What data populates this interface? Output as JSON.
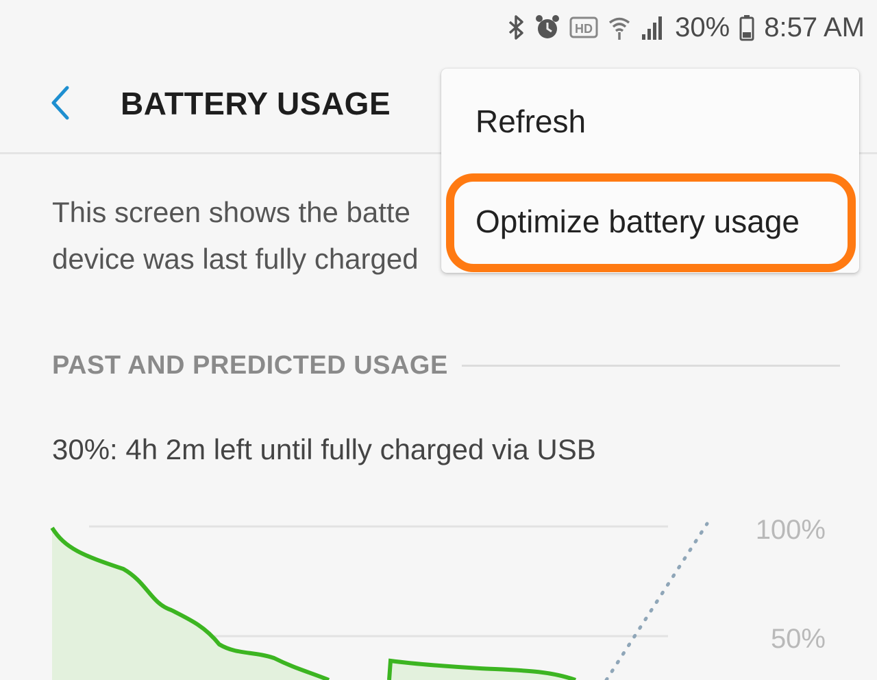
{
  "status_bar": {
    "icons": [
      "bluetooth-icon",
      "alarm-icon",
      "hd-icon",
      "wifi-icon",
      "signal-icon",
      "battery-icon"
    ],
    "battery_percent": "30%",
    "time": "8:57 AM"
  },
  "header": {
    "back_icon": "chevron-left-icon",
    "title": "BATTERY USAGE"
  },
  "description": {
    "line1": "This screen shows the batte",
    "line2": "device was last fully charged"
  },
  "section": {
    "title": "PAST AND PREDICTED USAGE"
  },
  "charge_status": "30%: 4h 2m left until fully charged via USB",
  "chart": {
    "labels": [
      "100%",
      "50%"
    ],
    "colors": {
      "line": "#3cb521",
      "fill": "#e3f1dd",
      "prediction": "#8fa6b8",
      "grid": "#e2e2e2"
    }
  },
  "menu": {
    "items": [
      "Refresh",
      "Optimize battery usage"
    ],
    "highlight_color": "#ff7a12"
  }
}
